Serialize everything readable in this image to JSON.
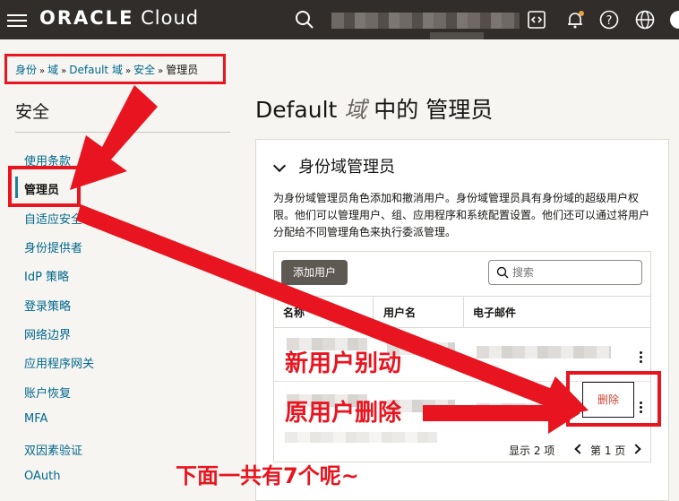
{
  "topbar": {
    "logo_bold": "ORACLE",
    "logo_light": " Cloud",
    "icons": [
      "hamburger-icon",
      "search-icon",
      "code-icon",
      "bell-icon",
      "help-icon",
      "globe-icon"
    ]
  },
  "breadcrumb": {
    "items": [
      "身份",
      "域",
      "Default 域",
      "安全"
    ],
    "current": "管理员",
    "separator": "»"
  },
  "sidebar": {
    "title": "安全",
    "items": [
      {
        "label": "使用条款"
      },
      {
        "label": "管理员",
        "active": true
      },
      {
        "label": "自适应安全"
      },
      {
        "label": "身份提供者"
      },
      {
        "label": "IdP 策略"
      },
      {
        "label": "登录策略"
      },
      {
        "label": "网络边界"
      },
      {
        "label": "应用程序网关"
      },
      {
        "label": "账户恢复"
      },
      {
        "label": "MFA"
      },
      {
        "label": "双因素验证"
      },
      {
        "label": "OAuth"
      }
    ]
  },
  "main": {
    "title_prefix": "Default ",
    "title_italic": "域",
    "title_suffix": " 中的 管理员",
    "section_title": "身份域管理员",
    "description": "为身份域管理员角色添加和撤消用户。身份域管理员具有身份域的超级用户权限。他们可以管理用户、组、应用程序和系统配置设置。他们还可以通过将用户分配给不同管理角色来执行委派管理。",
    "add_button": "添加用户",
    "search_placeholder": "搜索",
    "columns": [
      "名称",
      "用户名",
      "电子邮件"
    ],
    "row_menu_item": "删除",
    "pager_count": "显示 2 项",
    "pager_page": "第 1 页"
  },
  "annotations": {
    "new_user": "新用户别动",
    "old_user": "原用户删除",
    "bottom_note": "下面一共有7个呢~"
  },
  "colors": {
    "topbar": "#312d2a",
    "link": "#00688c",
    "annotation_red": "#e8141f",
    "delete_text": "#c74634"
  }
}
